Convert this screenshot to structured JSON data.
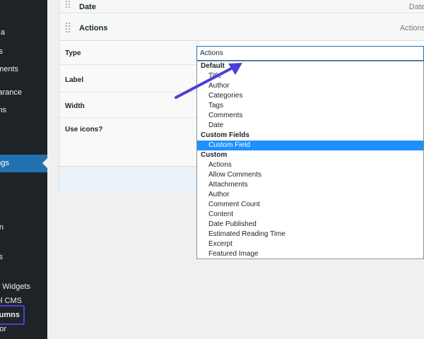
{
  "sidebar": {
    "items": [
      {
        "label": "a"
      },
      {
        "label": "s"
      },
      {
        "label": "mments"
      },
      {
        "label": "arance"
      },
      {
        "label": "ns"
      },
      {
        "label": "ngs"
      },
      {
        "label": "n"
      },
      {
        "label": "s"
      },
      {
        "label": "d Widgets"
      },
      {
        "label": "el CMS"
      },
      {
        "label": "lumns"
      },
      {
        "label": "or"
      }
    ]
  },
  "columns": {
    "rows": [
      {
        "title": "Date",
        "type": "Date"
      },
      {
        "title": "Actions",
        "type": "Actions"
      }
    ]
  },
  "settings": {
    "labels": {
      "type": "Type",
      "label": "Label",
      "width": "Width",
      "use_icons": "Use icons?"
    }
  },
  "type_select": {
    "value": "Actions",
    "groups": [
      {
        "label": "Default",
        "options": [
          "Title",
          "Author",
          "Categories",
          "Tags",
          "Comments",
          "Date"
        ]
      },
      {
        "label": "Custom Fields",
        "options": [
          "Custom Field"
        ]
      },
      {
        "label": "Custom",
        "options": [
          "Actions",
          "Allow Comments",
          "Attachments",
          "Author",
          "Comment Count",
          "Content",
          "Date Published",
          "Estimated Reading Time",
          "Excerpt",
          "Featured Image"
        ]
      }
    ],
    "selected_option": "Custom Field"
  },
  "colors": {
    "sidebar_bg": "#1d2327",
    "active_menu": "#2271b1",
    "highlight_box": "#4b3fd9",
    "selected_option": "#1e90ff",
    "arrow": "#4b3fd9"
  }
}
